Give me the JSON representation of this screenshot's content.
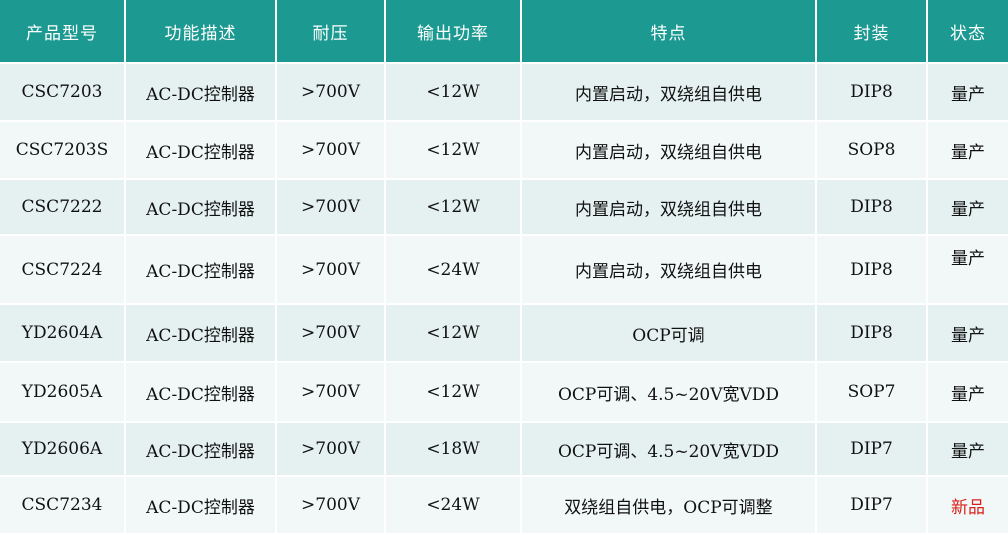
{
  "headers": [
    "产品型号",
    "功能描述",
    "耐压",
    "输出功率",
    "特点",
    "封装",
    "状态"
  ],
  "rows": [
    [
      "CSC7203",
      "AC-DC控制器",
      ">700V",
      "<12W",
      "内置启动，双绕组自供电",
      "DIP8",
      "量产"
    ],
    [
      "CSC7203S",
      "AC-DC控制器",
      ">700V",
      "<12W",
      "内置启动，双绕组自供电",
      "SOP8",
      "量产"
    ],
    [
      "CSC7222",
      "AC-DC控制器",
      ">700V",
      "<12W",
      "内置启动，双绕组自供电",
      "DIP8",
      "量产"
    ],
    [
      "CSC7224",
      "AC-DC控制器",
      ">700V",
      "<24W",
      "内置启动，双绕组自供电",
      "DIP8",
      "量产"
    ],
    [
      "YD2604A",
      "AC-DC控制器",
      ">700V",
      "<12W",
      "OCP可调",
      "DIP8",
      "量产"
    ],
    [
      "YD2605A",
      "AC-DC控制器",
      ">700V",
      "<12W",
      "OCP可调、4.5~20V宽VDD",
      "SOP7",
      "量产"
    ],
    [
      "YD2606A",
      "AC-DC控制器",
      ">700V",
      "<18W",
      "OCP可调、4.5~20V宽VDD",
      "DIP7",
      "量产"
    ],
    [
      "CSC7234",
      "AC-DC控制器",
      ">700V",
      "<24W",
      "双绕组自供电，OCP可调整",
      "DIP7",
      "新品"
    ]
  ],
  "colors": {
    "header_bg": "#1c9a91",
    "row_odd_bg": "#e4f1f0",
    "row_even_bg": "#f2f8f8",
    "status_new": "#d9201a"
  }
}
